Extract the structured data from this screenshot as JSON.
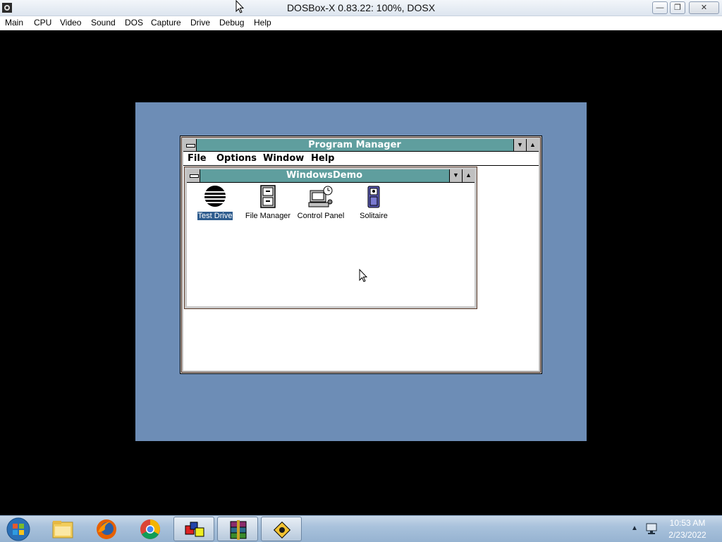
{
  "window": {
    "title": "DOSBox-X 0.83.22: 100%, DOSX",
    "minimize_icon": "minimize-icon",
    "restore_icon": "restore-icon",
    "close_label": "✕"
  },
  "host_menu": [
    "Main",
    "CPU",
    "Video",
    "Sound",
    "DOS",
    "Capture",
    "Drive",
    "Debug",
    "Help"
  ],
  "program_manager": {
    "title": "Program Manager",
    "menu": [
      "File",
      "Options",
      "Window",
      "Help"
    ],
    "group": {
      "title": "WindowsDemo",
      "icons": [
        {
          "label": "Test Drive",
          "icon": "test-drive-icon",
          "selected": true
        },
        {
          "label": "File Manager",
          "icon": "file-cabinet-icon",
          "selected": false
        },
        {
          "label": "Control Panel",
          "icon": "control-panel-icon",
          "selected": false
        },
        {
          "label": "Solitaire",
          "icon": "card-deck-icon",
          "selected": false
        }
      ]
    }
  },
  "taskbar": {
    "items": [
      {
        "name": "windows-explorer",
        "icon": "folder-icon"
      },
      {
        "name": "firefox",
        "icon": "firefox-icon"
      },
      {
        "name": "chrome",
        "icon": "chrome-icon"
      },
      {
        "name": "window-app",
        "icon": "colored-windows-icon"
      },
      {
        "name": "winrar",
        "icon": "winrar-icon"
      },
      {
        "name": "dosbox",
        "icon": "dosbox-icon"
      }
    ],
    "clock_time": "10:53 AM",
    "clock_date": "2/23/2022"
  },
  "colors": {
    "desktop": "#6d8db6",
    "title_bar": "#5f9e9e",
    "selection": "#2e5c8e"
  }
}
